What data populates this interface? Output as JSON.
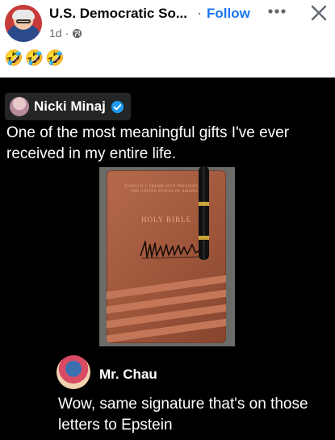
{
  "post": {
    "page_name": "U.S. Democratic So...",
    "separator": "·",
    "follow_label": "Follow",
    "time": "1d",
    "meta_separator": "·",
    "reactions": [
      "🤣",
      "🤣",
      "🤣"
    ]
  },
  "embed": {
    "quoted_author": "Nicki Minaj",
    "quoted_text": "One of the most meaningful gifts I've ever received in my entire life.",
    "bible": {
      "header": "DONALD J. TRUMP 45TH PRESIDENT OF THE UNITED STATES OF AMERICA",
      "title": "HOLY BIBLE"
    },
    "commenter_name": "Mr. Chau",
    "comment_text": "Wow, same signature that's on those letters to Epstein"
  },
  "colors": {
    "follow": "#1877f2",
    "meta": "#65676b",
    "embed_background": "#000000",
    "bible_cover": "#a65c40"
  },
  "icons": {
    "more": "more-horizontal-icon",
    "close": "close-icon",
    "audience": "globe-icon",
    "verified": "verified-badge-icon"
  }
}
